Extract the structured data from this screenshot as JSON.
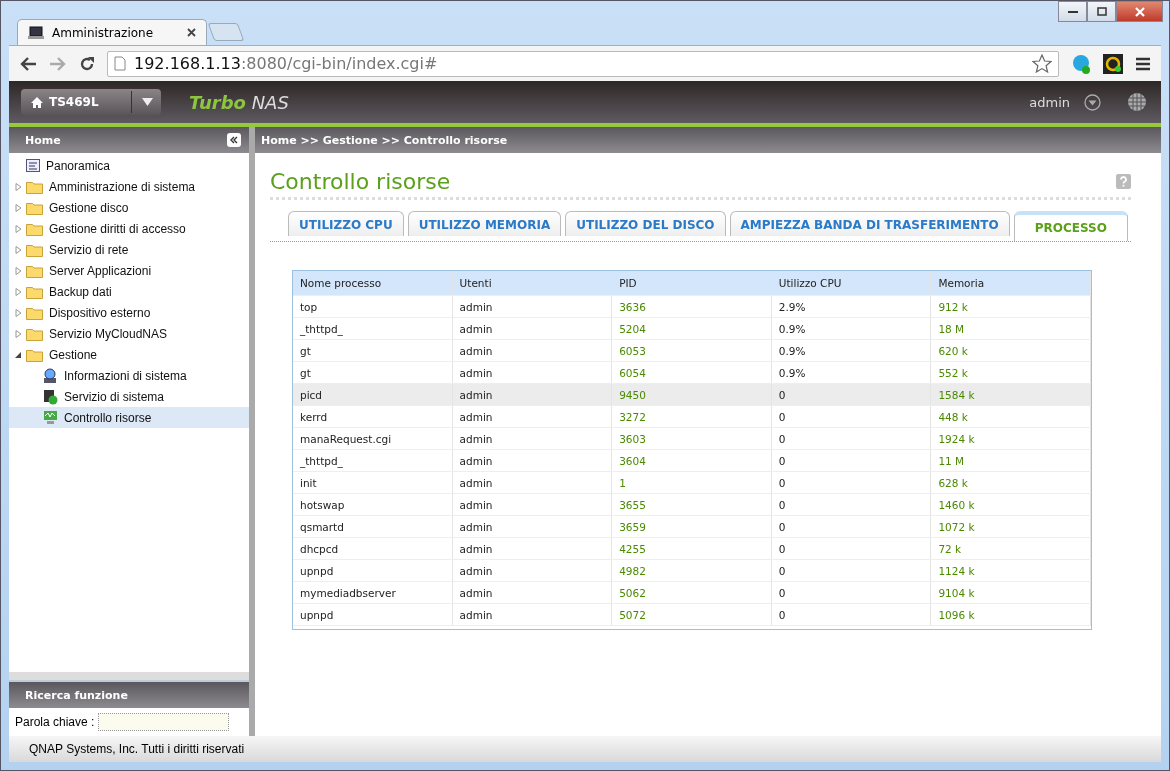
{
  "browser": {
    "tab_title": "Amministrazione",
    "url_host": "192.168.1.13",
    "url_rest": ":8080/cgi-bin/index.cgi#"
  },
  "header": {
    "device": "TS469L",
    "brand_bold": "Turbo",
    "brand_rest": "NAS",
    "user": "admin"
  },
  "sidebar": {
    "title": "Home",
    "items": [
      {
        "label": "Panoramica",
        "kind": "page",
        "selected": false
      },
      {
        "label": "Amministrazione di sistema",
        "kind": "folder",
        "expanded": false,
        "selected": false
      },
      {
        "label": "Gestione disco",
        "kind": "folder",
        "expanded": false,
        "selected": false
      },
      {
        "label": "Gestione diritti di accesso",
        "kind": "folder",
        "expanded": false,
        "selected": false
      },
      {
        "label": "Servizio di rete",
        "kind": "folder",
        "expanded": false,
        "selected": false
      },
      {
        "label": "Server Applicazioni",
        "kind": "folder",
        "expanded": false,
        "selected": false
      },
      {
        "label": "Backup dati",
        "kind": "folder",
        "expanded": false,
        "selected": false
      },
      {
        "label": "Dispositivo esterno",
        "kind": "folder",
        "expanded": false,
        "selected": false
      },
      {
        "label": "Servizio MyCloudNAS",
        "kind": "folder",
        "expanded": false,
        "selected": false
      },
      {
        "label": "Gestione",
        "kind": "folder",
        "expanded": true,
        "selected": false,
        "children": [
          {
            "label": "Informazioni di sistema",
            "kind": "page",
            "selected": false
          },
          {
            "label": "Servizio di sistema",
            "kind": "page",
            "selected": false
          },
          {
            "label": "Controllo risorse",
            "kind": "page",
            "selected": true
          }
        ]
      }
    ]
  },
  "search": {
    "title": "Ricerca funzione",
    "label": "Parola chiave :"
  },
  "breadcrumb": "Home >> Gestione >> Controllo risorse",
  "page_title": "Controllo risorse",
  "tabs": [
    {
      "label": "UTILIZZO CPU",
      "selected": false
    },
    {
      "label": "UTILIZZO MEMORIA",
      "selected": false
    },
    {
      "label": "UTILIZZO DEL DISCO",
      "selected": false
    },
    {
      "label": "AMPIEZZA BANDA DI TRASFERIMENTO",
      "selected": false
    },
    {
      "label": "PROCESSO",
      "selected": true
    }
  ],
  "table": {
    "columns": [
      "Nome processo",
      "Utenti",
      "PID",
      "Utilizzo CPU",
      "Memoria"
    ],
    "rows": [
      {
        "cells": [
          "top",
          "admin",
          "3636",
          "2.9%",
          "912 k"
        ],
        "selected": false
      },
      {
        "cells": [
          "_thttpd_",
          "admin",
          "5204",
          "0.9%",
          "18 M"
        ],
        "selected": false
      },
      {
        "cells": [
          "gt",
          "admin",
          "6053",
          "0.9%",
          "620 k"
        ],
        "selected": false
      },
      {
        "cells": [
          "gt",
          "admin",
          "6054",
          "0.9%",
          "552 k"
        ],
        "selected": false
      },
      {
        "cells": [
          "picd",
          "admin",
          "9450",
          "0",
          "1584 k"
        ],
        "selected": true
      },
      {
        "cells": [
          "kerrd",
          "admin",
          "3272",
          "0",
          "448 k"
        ],
        "selected": false
      },
      {
        "cells": [
          "manaRequest.cgi",
          "admin",
          "3603",
          "0",
          "1924 k"
        ],
        "selected": false
      },
      {
        "cells": [
          "_thttpd_",
          "admin",
          "3604",
          "0",
          "11 M"
        ],
        "selected": false
      },
      {
        "cells": [
          "init",
          "admin",
          "1",
          "0",
          "628 k"
        ],
        "selected": false
      },
      {
        "cells": [
          "hotswap",
          "admin",
          "3655",
          "0",
          "1460 k"
        ],
        "selected": false
      },
      {
        "cells": [
          "qsmartd",
          "admin",
          "3659",
          "0",
          "1072 k"
        ],
        "selected": false
      },
      {
        "cells": [
          "dhcpcd",
          "admin",
          "4255",
          "0",
          "72 k"
        ],
        "selected": false
      },
      {
        "cells": [
          "upnpd",
          "admin",
          "4982",
          "0",
          "1124 k"
        ],
        "selected": false
      },
      {
        "cells": [
          "mymediadbserver",
          "admin",
          "5062",
          "0",
          "9104 k"
        ],
        "selected": false
      },
      {
        "cells": [
          "upnpd",
          "admin",
          "5072",
          "0",
          "1096 k"
        ],
        "selected": false
      }
    ]
  },
  "footer": "QNAP Systems, Inc. Tutti i diritti riservati"
}
